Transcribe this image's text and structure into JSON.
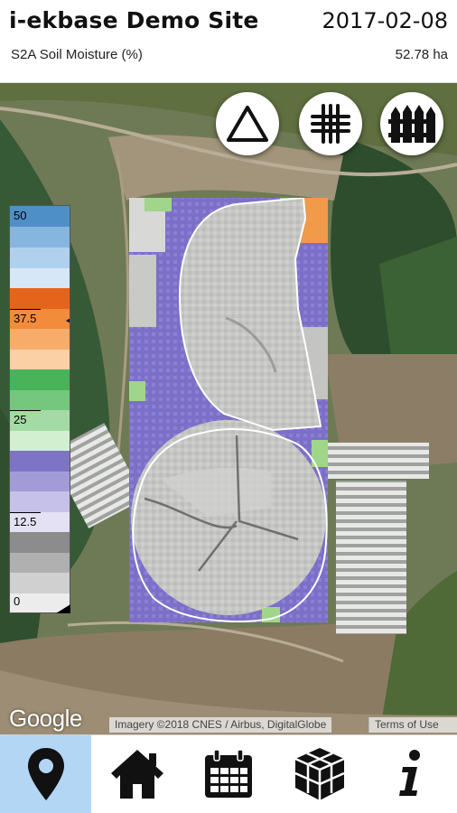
{
  "header": {
    "site_title": "i-ekbase Demo Site",
    "date": "2017-02-08",
    "layer_name": "S2A Soil Moisture (%)",
    "area": "52.78 ha"
  },
  "map": {
    "buttons": [
      {
        "icon": "triangle-draw-icon"
      },
      {
        "icon": "grid-icon"
      },
      {
        "icon": "fence-icon"
      }
    ],
    "legend": {
      "ticks": [
        "50",
        "37.5",
        "25",
        "12.5",
        "0"
      ],
      "current_value": 36
    },
    "google_logo": "Google",
    "attribution": "Imagery ©2018 CNES / Airbus, DigitalGlobe",
    "terms": "Terms of Use"
  },
  "nav": {
    "items": [
      {
        "icon": "map-pin-icon",
        "active": true
      },
      {
        "icon": "home-icon",
        "active": false
      },
      {
        "icon": "calendar-icon",
        "active": false
      },
      {
        "icon": "cubes-icon",
        "active": false
      },
      {
        "icon": "info-icon",
        "active": false
      }
    ]
  },
  "colors": {
    "nav_active": "#b3d6f5",
    "field_outline": "#ffffff",
    "dry_purple": "#7b6fc8"
  }
}
